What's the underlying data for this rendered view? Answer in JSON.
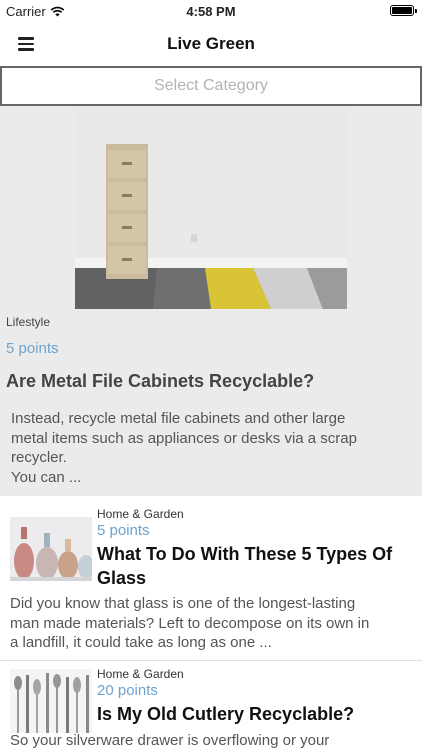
{
  "status_bar": {
    "carrier": "Carrier",
    "time": "4:58 PM"
  },
  "nav": {
    "title": "Live Green",
    "menu_icon": "hamburger-icon"
  },
  "category_select": {
    "placeholder": "Select Category"
  },
  "featured": {
    "category": "Lifestyle",
    "points": "5 points",
    "title": "Are Metal File Cabinets Recyclable?",
    "excerpt_lines": [
      "Instead, recycle metal file cabinets and other large",
      "metal items such as appliances or desks via a scrap",
      "recycler.",
      "You can ..."
    ]
  },
  "articles": [
    {
      "category": "Home & Garden",
      "points": "5 points",
      "title": "What To Do With These 5 Types Of Glass",
      "excerpt_lines": [
        "Did you know that glass is one of the longest-lasting",
        "man made materials? Left to decompose on its own in",
        "a landfill, it could take as long as one ..."
      ]
    },
    {
      "category": "Home & Garden",
      "points": "20 points",
      "title": "Is My Old Cutlery Recyclable?",
      "excerpt_lines": [
        "So your silverware drawer is overflowing or your"
      ]
    }
  ]
}
